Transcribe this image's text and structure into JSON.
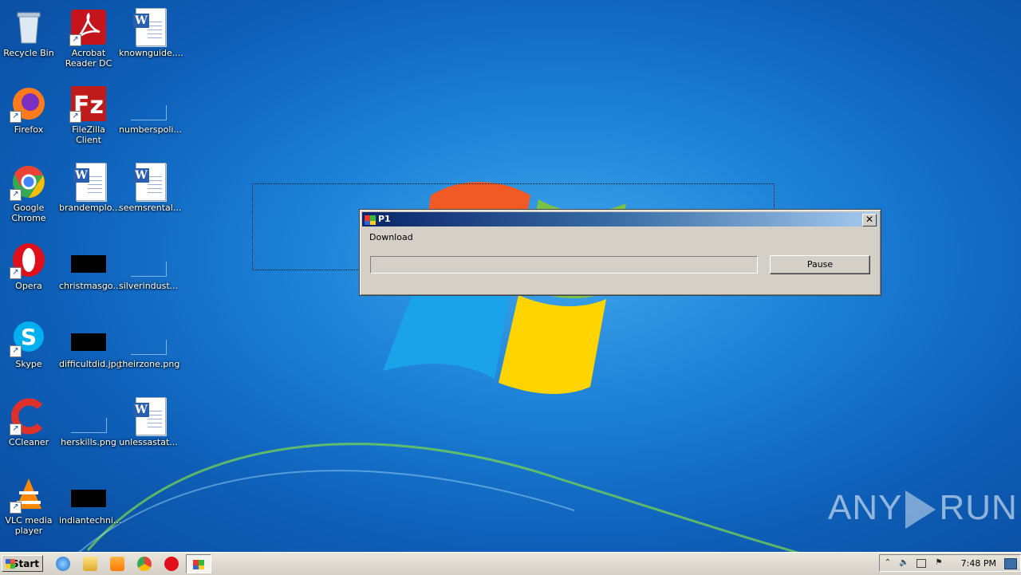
{
  "desktop": {
    "icons": [
      {
        "label": "Recycle Bin",
        "icon": "recycle-bin-icon"
      },
      {
        "label": "Acrobat\nReader DC",
        "icon": "acrobat-icon"
      },
      {
        "label": "knownguide....",
        "icon": "word-doc-icon"
      },
      {
        "label": "Firefox",
        "icon": "firefox-icon"
      },
      {
        "label": "FileZilla Client",
        "icon": "filezilla-icon"
      },
      {
        "label": "numberspoli...",
        "icon": "blank-file-icon"
      },
      {
        "label": "Google\nChrome",
        "icon": "chrome-icon"
      },
      {
        "label": "brandemplo...",
        "icon": "word-doc-icon"
      },
      {
        "label": "seemsrental...",
        "icon": "word-doc-icon"
      },
      {
        "label": "Opera",
        "icon": "opera-icon"
      },
      {
        "label": "christmasgo...",
        "icon": "black-image-icon"
      },
      {
        "label": "silverindust...",
        "icon": "blank-file-icon"
      },
      {
        "label": "Skype",
        "icon": "skype-icon"
      },
      {
        "label": "difficultdid.jpg",
        "icon": "black-image-icon"
      },
      {
        "label": "theirzone.png",
        "icon": "blank-file-icon"
      },
      {
        "label": "CCleaner",
        "icon": "ccleaner-icon"
      },
      {
        "label": "herskills.png",
        "icon": "blank-file-icon"
      },
      {
        "label": "unlessastat...",
        "icon": "word-doc-icon"
      },
      {
        "label": "VLC media\nplayer",
        "icon": "vlc-icon"
      },
      {
        "label": "indiantechni...",
        "icon": "black-image-icon"
      }
    ]
  },
  "dialog": {
    "title": "P1",
    "label": "Download",
    "progress": 0,
    "pause_label": "Pause",
    "close_glyph": "✕"
  },
  "watermark": {
    "left": "ANY",
    "right": "RUN"
  },
  "taskbar": {
    "start_label": "Start",
    "quick_launch": [
      "internet-explorer-icon",
      "explorer-folder-icon",
      "media-player-icon",
      "chrome-icon",
      "opera-icon"
    ],
    "active_task_icon": "p1-app-icon",
    "clock": "7:48 PM"
  },
  "colors": {
    "title_start": "#0a246a",
    "title_end": "#a6caf0",
    "dialog_face": "#d4d0c8"
  }
}
